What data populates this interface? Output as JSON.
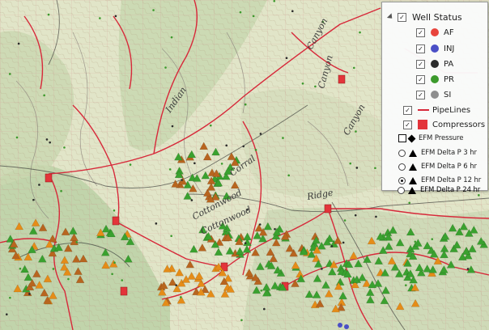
{
  "colors": {
    "AF": "#e8443c",
    "INJ": "#4a4fc6",
    "PA": "#2b2b2b",
    "PR": "#3c9a2c",
    "SI": "#8e8e8e",
    "pipeline": "#d7293a",
    "compressor": "#e3343a",
    "well_orange": "#e58c18",
    "well_brown": "#b8651f",
    "well_green": "#3aa12f"
  },
  "map": {
    "labels": [
      {
        "text": "Canyon",
        "rot": -62
      },
      {
        "text": "Indian",
        "rot": -55
      },
      {
        "text": "Canyon",
        "rot": -75
      },
      {
        "text": "Canyon",
        "rot": -60
      },
      {
        "text": "Cottonwood",
        "rot": -25
      },
      {
        "text": "Corral",
        "rot": -35
      },
      {
        "text": "Cottonwood",
        "rot": -28
      },
      {
        "text": "Ridge",
        "rot": -10
      }
    ]
  },
  "legend": {
    "title": "Well Status",
    "title_checked": true,
    "items": [
      {
        "label": "AF",
        "checked": true,
        "color_key": "AF"
      },
      {
        "label": "INJ",
        "checked": true,
        "color_key": "INJ"
      },
      {
        "label": "PA",
        "checked": true,
        "color_key": "PA"
      },
      {
        "label": "PR",
        "checked": true,
        "color_key": "PR"
      },
      {
        "label": "SI",
        "checked": true,
        "color_key": "SI"
      }
    ],
    "pipelines_label": "PipeLines",
    "pipelines_checked": true,
    "compressors_label": "Compressors",
    "compressors_checked": true,
    "efm_pressure_label": "EFM Pressure",
    "efm_pressure_checked": false,
    "efm_options": [
      {
        "label": "EFM Delta P 3 hr",
        "selected": false
      },
      {
        "label": "EFM Delta P 6 hr",
        "selected": false
      },
      {
        "label": "EFM Delta P 12 hr",
        "selected": true
      },
      {
        "label": "EFM Delta P 24 hr",
        "selected": false
      }
    ]
  }
}
